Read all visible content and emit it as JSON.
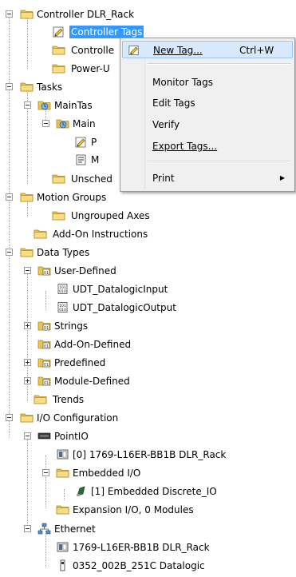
{
  "tree": {
    "controller": "Controller DLR_Rack",
    "controller_tags": "Controller Tags",
    "controller_faults": "Controlle",
    "power_up": "Power-U",
    "tasks": "Tasks",
    "main_task": "MainTas",
    "main_program": "Main",
    "program_item_1": "P",
    "program_item_2": "M",
    "unscheduled": "Unsched",
    "motion_groups": "Motion Groups",
    "ungrouped_axes": "Ungrouped Axes",
    "add_on_instructions": "Add-On Instructions",
    "data_types": "Data Types",
    "user_defined": "User-Defined",
    "udt_input": "UDT_DatalogicInput",
    "udt_output": "UDT_DatalogicOutput",
    "strings": "Strings",
    "add_on_defined": "Add-On-Defined",
    "predefined": "Predefined",
    "module_defined": "Module-Defined",
    "trends": "Trends",
    "io_configuration": "I/O Configuration",
    "point_io": "PointIO",
    "controller_module": "[0] 1769-L16ER-BB1B DLR_Rack",
    "embedded_io": "Embedded I/O",
    "embedded_discrete": "[1] Embedded Discrete_IO",
    "expansion_io": "Expansion I/O, 0 Modules",
    "ethernet": "Ethernet",
    "ethernet_controller": "1769-L16ER-BB1B DLR_Rack",
    "datalogic_device": "0352_002B_251C Datalogic"
  },
  "context_menu": {
    "new_tag": "New Tag...",
    "new_tag_shortcut": "Ctrl+W",
    "monitor_tags": "Monitor Tags",
    "edit_tags": "Edit Tags",
    "verify": "Verify",
    "export_tags": "Export Tags...",
    "print": "Print",
    "submenu_arrow": "▶"
  },
  "colors": {
    "selection": "#3399ff",
    "menu_highlight": "#d8e9fb",
    "folder": "#f2d36b"
  }
}
